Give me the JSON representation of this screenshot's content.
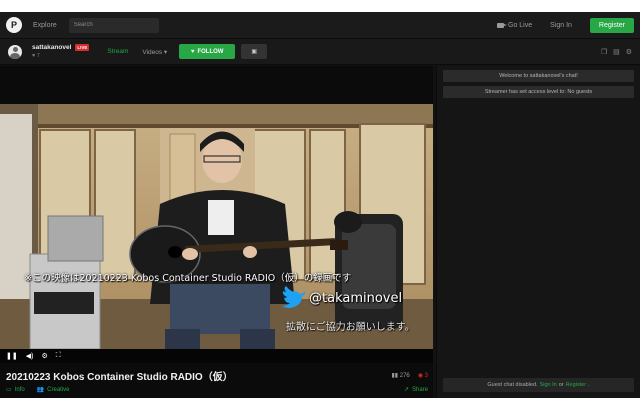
{
  "nav": {
    "explore_label": "Explore",
    "search_placeholder": "Search",
    "golive_label": "Go Live",
    "signin_label": "Sign In",
    "register_label": "Register"
  },
  "channel": {
    "name": "sattakanovel",
    "live_badge": "LIVE",
    "followers": "♥ 7",
    "tab_stream": "Stream",
    "tab_videos": "Videos ▾",
    "follow_label": "FOLLOW",
    "accent": "#27a745"
  },
  "video": {
    "overlay_caption": "※この映像は20210223 Kobos Container Studio RADIO（仮）の録画です",
    "overlay_handle": "@takaminovel",
    "overlay_request": "拡散にご協力お願いします。"
  },
  "stream": {
    "title": "20210223 Kobos Container Studio RADIO（仮）",
    "viewers": "276",
    "likes": "3",
    "info_label": "Info",
    "category_label": "Creative",
    "share_label": "Share"
  },
  "chat": {
    "welcome": "Welcome to sattakanovel's chat!",
    "access_notice": "Streamer has set access level to: No guests",
    "footer_text": "Guest chat disabled.",
    "footer_signin": "Sign In",
    "footer_or": "or",
    "footer_register": "Register",
    "footer_end": "."
  }
}
